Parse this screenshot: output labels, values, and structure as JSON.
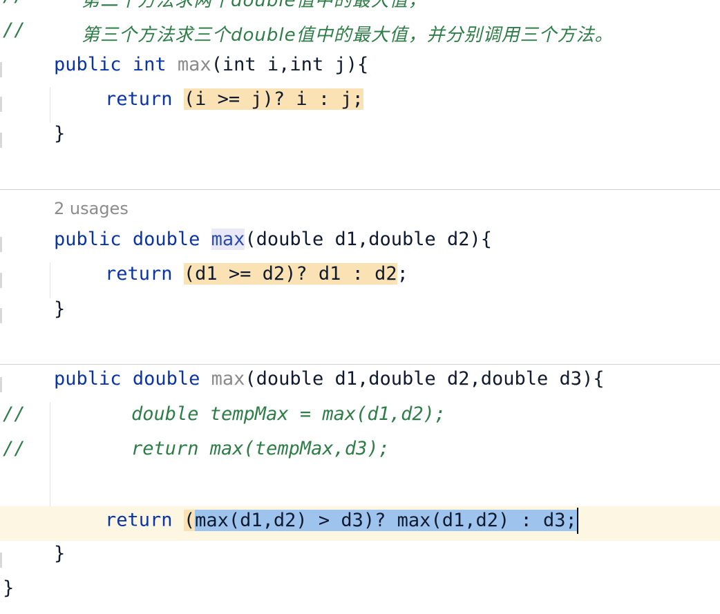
{
  "comments": {
    "line1_slash": "//",
    "line1_text": "第二个方法求两个double值中的最大值，",
    "line2_slash": "//",
    "line2_text": "第三个方法求三个double值中的最大值，并分别调用三个方法。"
  },
  "method1": {
    "kw_public": "public",
    "kw_type": "int",
    "name": "max",
    "params": "(int i,int j){",
    "ret_kw": "return",
    "ret_expr": "(i >= j)? i : j;",
    "close": "}"
  },
  "method2": {
    "usages": "2 usages",
    "kw_public": "public",
    "kw_type": "double",
    "name": "max",
    "params": "(double d1,double d2){",
    "ret_kw": "return",
    "ret_expr": "(d1 >= d2)? d1 : d2",
    "ret_semicolon": ";",
    "close": "}"
  },
  "method3": {
    "kw_public": "public",
    "kw_type": "double",
    "name": "max",
    "params": "(double d1,double d2,double d3){",
    "comment1_slash": "//",
    "comment1_code": "double tempMax = max(d1,d2);",
    "comment2_slash": "//",
    "comment2_code": "return max(tempMax,d3);",
    "ret_kw": "return",
    "ret_paren": "(",
    "ret_selected": "max(d1,d2) > d3)? max(d1,d2) : d3;",
    "close": "}"
  },
  "class_close": "}"
}
